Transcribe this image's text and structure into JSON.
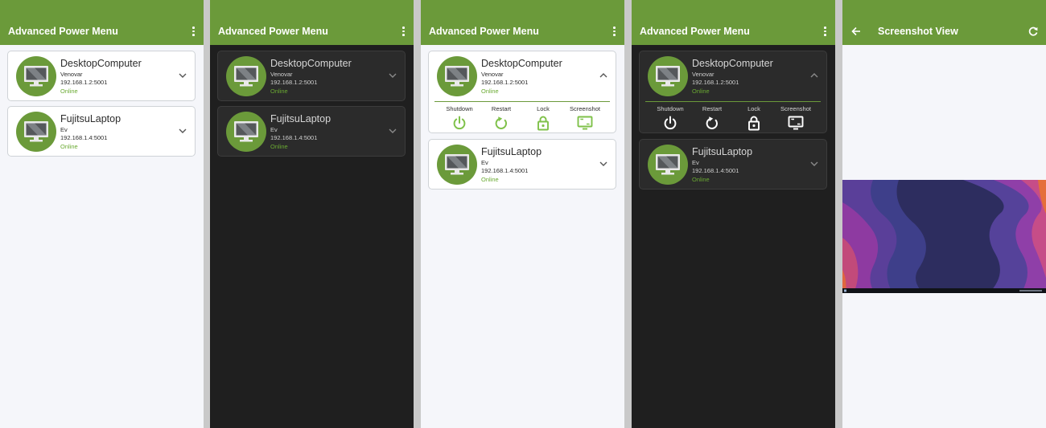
{
  "app_title": "Advanced Power Menu",
  "screenshot_view_title": "Screenshot View",
  "icons": {
    "menu": "more-vert-icon",
    "expand": "chevron-down-icon",
    "collapse": "chevron-up-icon",
    "device": "monitor-icon",
    "back": "arrow-left-icon",
    "refresh": "refresh-icon"
  },
  "colors": {
    "accent": "#6b9a3a",
    "online": "#6aaa32",
    "action_icon": "#7fc14a",
    "light_bg": "#f5f6fa",
    "dark_bg": "#1f1f1f"
  },
  "devices": [
    {
      "name": "DesktopComputer",
      "user": "Venovar",
      "address": "192.168.1.2:5001",
      "status": "Online"
    },
    {
      "name": "FujitsuLaptop",
      "user": "Ev",
      "address": "192.168.1.4:5001",
      "status": "Online"
    }
  ],
  "actions": [
    {
      "label": "Shutdown",
      "icon": "power-icon"
    },
    {
      "label": "Restart",
      "icon": "restart-icon"
    },
    {
      "label": "Lock",
      "icon": "lock-icon"
    },
    {
      "label": "Screenshot",
      "icon": "screenshot-icon"
    }
  ]
}
